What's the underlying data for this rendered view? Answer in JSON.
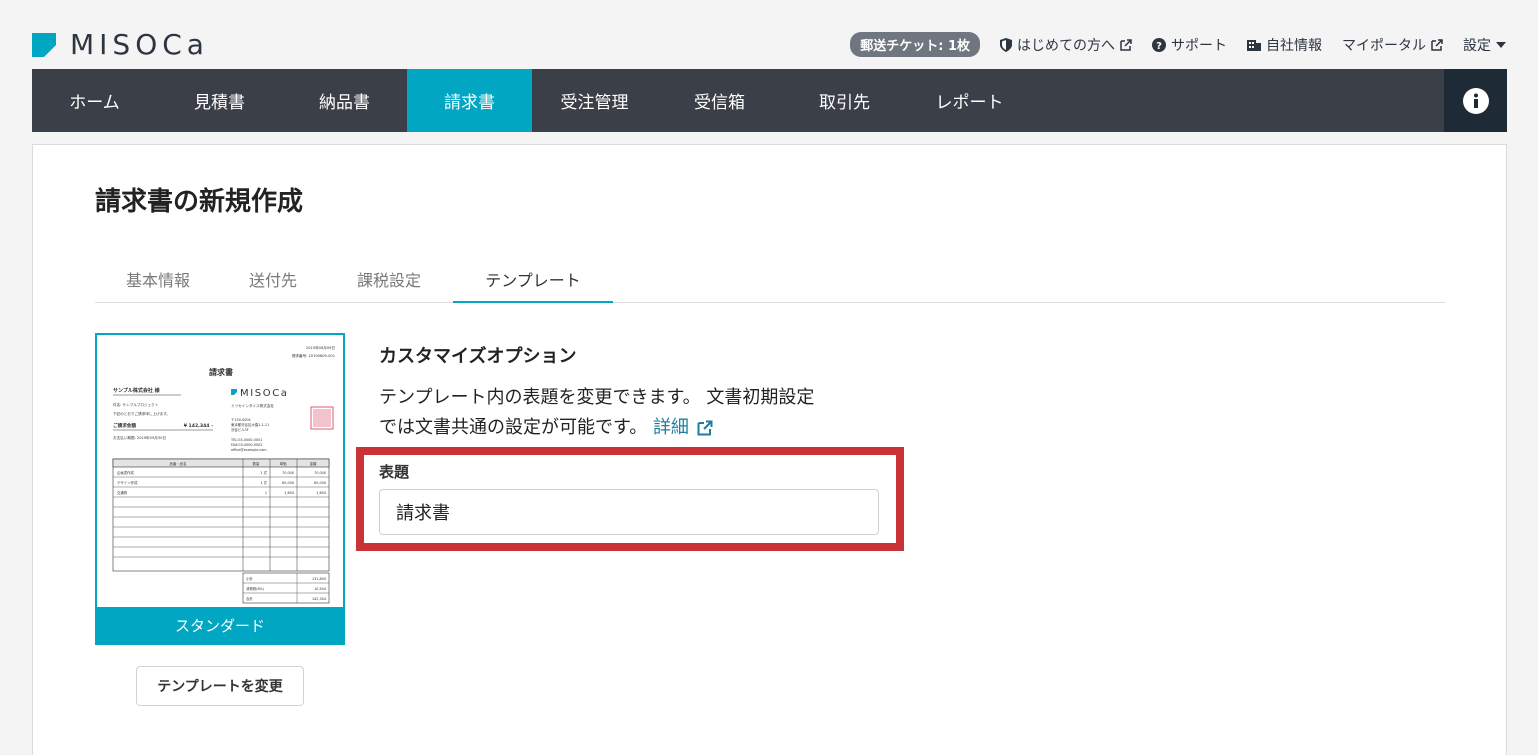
{
  "brand": {
    "name": "MISOCa",
    "color": "#00a6c2"
  },
  "top_links": {
    "ticket": "郵送チケット: 1枚",
    "first_time": "はじめての方へ",
    "support": "サポート",
    "company": "自社情報",
    "portal": "マイポータル",
    "settings": "設定"
  },
  "nav": {
    "items": [
      {
        "label": "ホーム"
      },
      {
        "label": "見積書"
      },
      {
        "label": "納品書"
      },
      {
        "label": "請求書",
        "active": true
      },
      {
        "label": "受注管理"
      },
      {
        "label": "受信箱"
      },
      {
        "label": "取引先"
      },
      {
        "label": "レポート"
      }
    ]
  },
  "page": {
    "title": "請求書の新規作成"
  },
  "tabs": [
    {
      "label": "基本情報"
    },
    {
      "label": "送付先"
    },
    {
      "label": "課税設定"
    },
    {
      "label": "テンプレート",
      "active": true
    }
  ],
  "template": {
    "name": "スタンダード",
    "change_label": "テンプレートを変更",
    "preview": {
      "doc_title": "請求書",
      "date": "2019年08月09日",
      "invoice_no": "請求番号: 20190809-001",
      "client": "サンプル株式会社 様",
      "subject": "件名: サンプルプロジェクト",
      "greeting": "下記のとおりご請求申し上げます。",
      "amount_label": "ご請求金額",
      "amount": "¥ 142,344 -",
      "due": "お支払い期限: 2019年09月30日",
      "sender": "ミツカインタイス株式会社",
      "zip": "〒150-0004",
      "address1": "東京都渋谷区大橋1-1-11",
      "address2": "渋谷ビル3F",
      "tel": "TEL:03-0000-0001",
      "fax": "FAX:03-0000-0002",
      "email": "office@example.com",
      "table_headers": [
        "品番・品名",
        "数量",
        "単価",
        "金額"
      ],
      "rows": [
        [
          "企画書作成",
          "1 式",
          "70,000",
          "70,000"
        ],
        [
          "デザイン作成",
          "1 式",
          "60,000",
          "60,000"
        ],
        [
          "交通費",
          "1",
          "1,600",
          "1,600"
        ]
      ],
      "totals": [
        [
          "小計",
          "131,800"
        ],
        [
          "消費税(8%)",
          "10,544"
        ],
        [
          "合計",
          "142,344"
        ]
      ]
    }
  },
  "options": {
    "title": "カスタマイズオプション",
    "desc_line1": "テンプレート内の表題を変更できます。 文書初期設定",
    "desc_line2": "では文書共通の設定が可能です。",
    "detail_link": "詳細",
    "field_label": "表題",
    "field_value": "請求書"
  },
  "colors": {
    "nav_bg": "#3b3f48",
    "accent": "#00a6c2",
    "highlight": "#c93237",
    "info_bg": "#1f2a37"
  }
}
